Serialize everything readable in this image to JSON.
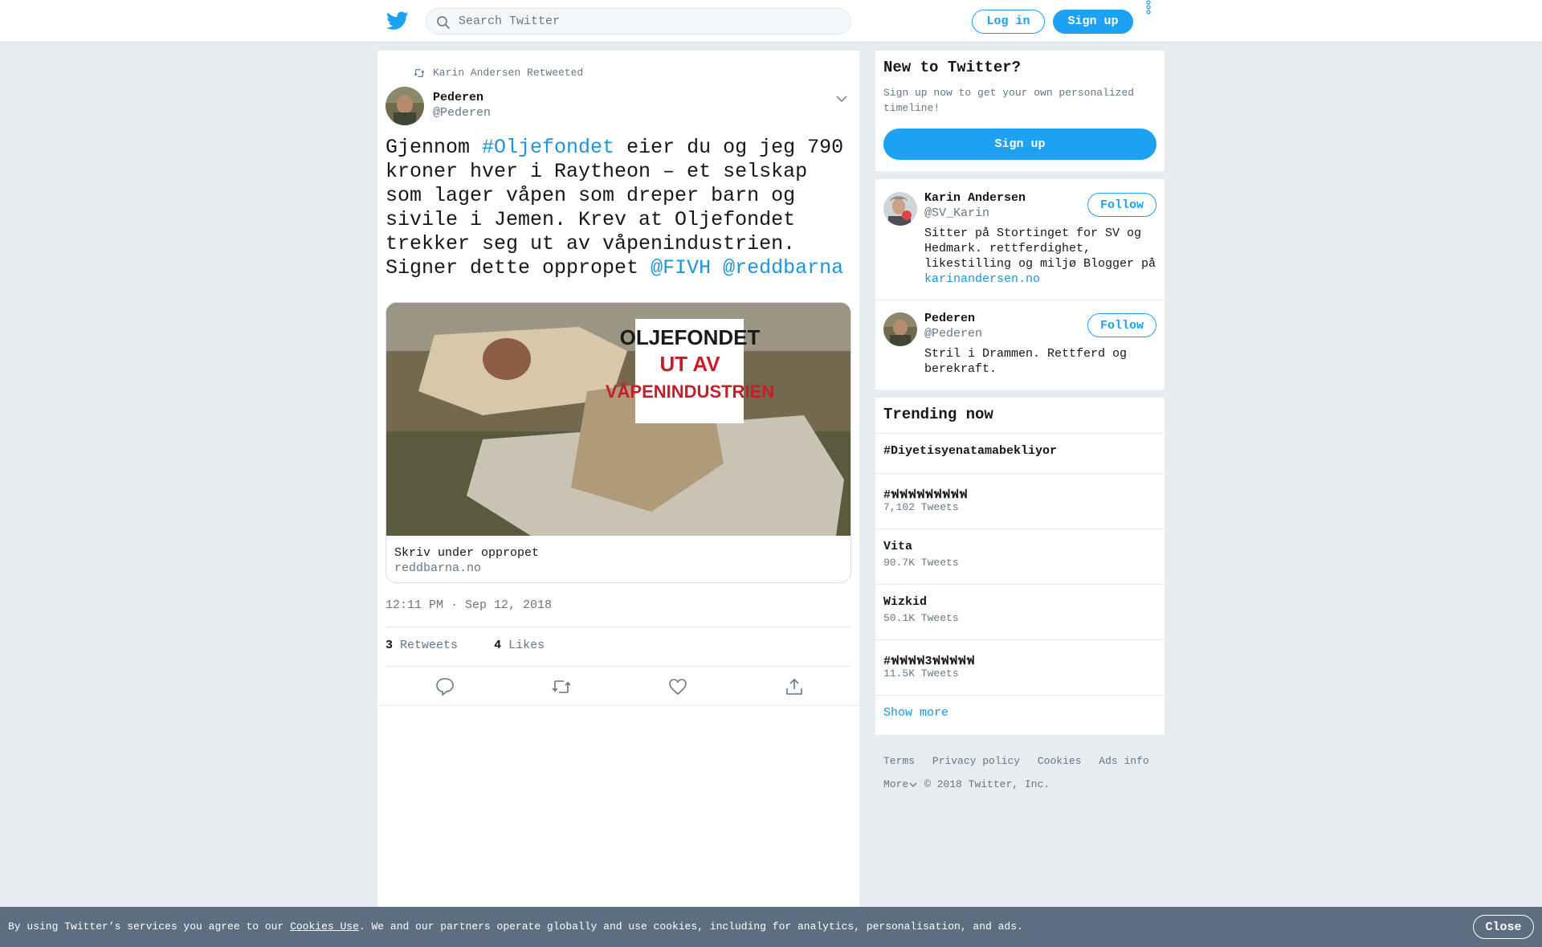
{
  "header": {
    "search_placeholder": "Search Twitter",
    "login_label": "Log in",
    "signup_label": "Sign up"
  },
  "tweet": {
    "retweet_context": "Karin Andersen Retweeted",
    "author_name": "Pederen",
    "author_handle": "@Pederen",
    "text_parts": {
      "p1": "Gjennom ",
      "hashtag": "#Oljefondet",
      "p2": " eier du og jeg 790 kroner hver i Raytheon – et selskap som lager våpen som dreper barn og sivile i Jemen. Krev at Oljefondet trekker seg ut av våpenindustrien. Signer dette oppropet ",
      "mention1": "@FIVH",
      "mention2": "@reddbarna"
    },
    "card": {
      "image_headline_1": "OLJEFONDET",
      "image_headline_2": "UT AV",
      "image_headline_3": "VÅPENINDUSTRIEN",
      "title": "Skriv under oppropet",
      "domain": "reddbarna.no"
    },
    "timestamp": "12:11 PM · Sep 12, 2018",
    "retweets_count": "3",
    "retweets_label": "Retweets",
    "likes_count": "4",
    "likes_label": "Likes"
  },
  "sidebar": {
    "new_to_twitter": {
      "title": "New to Twitter?",
      "subtitle": "Sign up now to get your own personalized timeline!",
      "signup_label": "Sign up"
    },
    "who_to_follow": [
      {
        "name": "Karin Andersen",
        "handle": "@SV_Karin",
        "bio": "Sitter på Stortinget for SV og Hedmark. rettferdighet, likestilling og miljø Blogger på ",
        "bio_link": "karinandersen.no",
        "follow_label": "Follow"
      },
      {
        "name": "Pederen",
        "handle": "@Pederen",
        "bio": "Stril i Drammen. Rettferd og berekraft.",
        "follow_label": "Follow"
      }
    ],
    "trending": {
      "title": "Trending now",
      "items": [
        {
          "name": "#Diyetisyenatamabekliyor",
          "count": ""
        },
        {
          "name": "#ฟฟฟฟฟฟฟฟฟ",
          "count": "7,102 Tweets"
        },
        {
          "name": "Vita",
          "count": "90.7K Tweets"
        },
        {
          "name": "Wizkid",
          "count": "50.1K Tweets"
        },
        {
          "name": "#ฟฟฟฟ3ฟฟฟฟฟ",
          "count": "11.5K Tweets"
        }
      ],
      "show_more": "Show more"
    },
    "footer": {
      "links": [
        "Terms",
        "Privacy policy",
        "Cookies",
        "Ads info"
      ],
      "more": "More",
      "copyright": "© 2018 Twitter, Inc."
    }
  },
  "cookie_bar": {
    "text_before": "By using Twitter’s services you agree to our ",
    "link": "Cookies Use",
    "text_after": ". We and our partners operate globally and use cookies, including for analytics, personalisation, and ads.",
    "close_label": "Close"
  },
  "colors": {
    "brand": "#1da1f2",
    "link": "#1b95e0",
    "background": "#e6ecf0",
    "cookie_bar": "#5c6e80"
  }
}
